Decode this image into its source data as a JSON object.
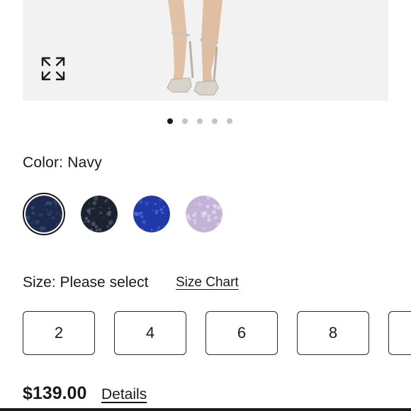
{
  "product_image": {
    "alt_icon": "expand-icon",
    "carousel": {
      "count": 5,
      "active_index": 0
    }
  },
  "color": {
    "label": "Color: Navy",
    "swatches": [
      {
        "name": "navy-sequin",
        "base": "#1c2a4d",
        "accent": "#3a4f80",
        "selected": true
      },
      {
        "name": "black-sequin",
        "base": "#1d2230",
        "accent": "#5a6377",
        "selected": false
      },
      {
        "name": "royal-blue-sequin",
        "base": "#1f3aa6",
        "accent": "#4e6fe0",
        "selected": false
      },
      {
        "name": "lavender-sequin",
        "base": "#c3b3d6",
        "accent": "#e6dcf0",
        "selected": false
      }
    ]
  },
  "size": {
    "label": "Size: Please select",
    "chart_link": "Size Chart",
    "options": [
      "2",
      "4",
      "6",
      "8",
      ""
    ]
  },
  "purchase": {
    "price": "$139.00",
    "details_link": "Details"
  }
}
